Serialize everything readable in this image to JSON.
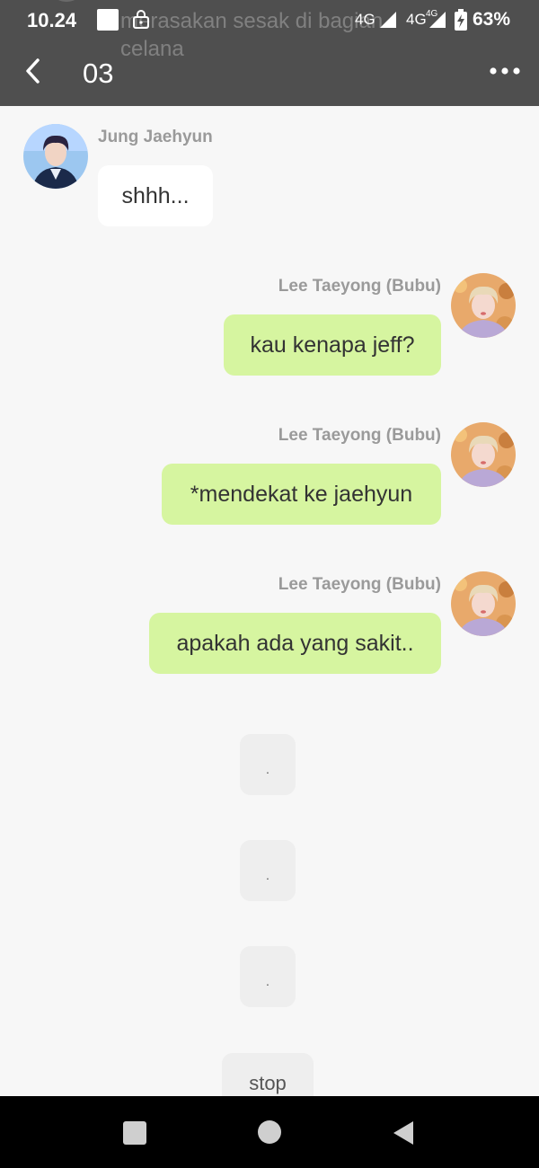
{
  "status_bar": {
    "time": "10.24",
    "network_1": "4G",
    "network_2": "4G",
    "network_2_sup": "4G",
    "battery": "63%"
  },
  "notification_ghost": {
    "text": "merasakan sesak di bagian celana"
  },
  "header": {
    "title": "03",
    "back_icon": "chevron-left-icon",
    "more_icon": "more-horizontal-icon"
  },
  "messages": [
    {
      "sender": "Jung Jaehyun",
      "text": "shhh...",
      "side": "left"
    },
    {
      "sender": "Lee Taeyong (Bubu)",
      "text": "kau kenapa jeff?",
      "side": "right"
    },
    {
      "sender": "Lee Taeyong (Bubu)",
      "text": "*mendekat ke jaehyun",
      "side": "right"
    },
    {
      "sender": "Lee Taeyong (Bubu)",
      "text": "apakah ada yang sakit..",
      "side": "right"
    }
  ],
  "narration": [
    {
      "text": "."
    },
    {
      "text": "."
    },
    {
      "text": "."
    },
    {
      "text": "stop"
    }
  ],
  "colors": {
    "header_bg": "#4f4f4f",
    "page_bg": "#f7f7f7",
    "bubble_right": "#d6f5a0",
    "bubble_left": "#ffffff",
    "bubble_narration": "#eeeeee"
  }
}
